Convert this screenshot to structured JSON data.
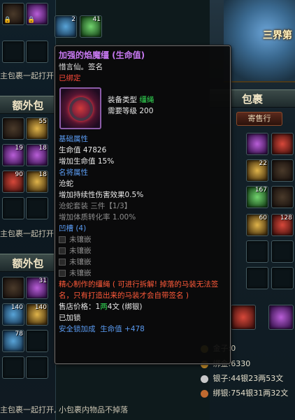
{
  "scene": {
    "title": "三界第"
  },
  "left_panel": {
    "hint_top": "主包裹一起打开",
    "extra_bag_title_1": "额外包",
    "hint_mid": "主包裹一起打开",
    "extra_bag_title_2": "额外包",
    "hint_bottom": "主包裹一起打开, 小包裹内物品不掉落",
    "slot_counts": {
      "top_2": "2",
      "top_3": "41",
      "row2_1": "55",
      "row3_0": "19",
      "row3_1": "18",
      "row4_0": "90",
      "row4_1": "18",
      "bag2_row0_1": "31",
      "bag2_row1_0": "140",
      "bag2_row1_1": "140",
      "bag2_row2_0": "78"
    }
  },
  "right_panel": {
    "title": "包裹",
    "tabs": [
      "背包",
      "寄售行"
    ],
    "slot_counts": {
      "r2_2": "22",
      "r3_1": "8",
      "r3_2": "167",
      "r4_1": "99",
      "r4_2": "60",
      "r4_3": "128"
    },
    "currency": {
      "gold_label": "金子",
      "gold_value": ":0",
      "bound_gold_label": "绑金",
      "bound_gold_value": ":6330",
      "silver_label": "银子",
      "silver_value": ":44银23两53文",
      "bound_silver_label": "绑银",
      "bound_silver_value": ":754银31两32文"
    }
  },
  "tooltip": {
    "title": "加强的焰魔缰 (生命值)",
    "maker": "惜言仙。签名",
    "bound_status": "已绑定",
    "equip_type_label": "装备类型",
    "equip_type_value": "缰绳",
    "required_level_label": "需要等级",
    "required_level_value": "200",
    "basic_attr_header": "基础属性",
    "hp_label": "生命值",
    "hp_value": "47826",
    "hp_bonus": "增加生命值 15%",
    "named_attr_header": "名将属性",
    "named_attr_name": "沧蛇",
    "named_attr_effect": "增加持续性伤害效果0.5%",
    "set_line": "沧蛇套装 三件【1/3】",
    "set_bonus": "增加体质转化率 1.00%",
    "socket_header": "凹槽 (4)",
    "socket_label": "未镶嵌",
    "description": "精心制作的缰绳 ( 可进行拆解! 掉落的马装无法签名，只有打造出来的马装才会自带签名 )",
    "price_label": "售店价格：",
    "price_prefix": "1",
    "price_liang": "两",
    "price_wen_value": "4",
    "price_wen": "文",
    "price_bound": "(绑银)",
    "locked": "已加锁",
    "lock_bonus_label": "安全锁加成",
    "lock_bonus_value": "生命值 +478"
  }
}
